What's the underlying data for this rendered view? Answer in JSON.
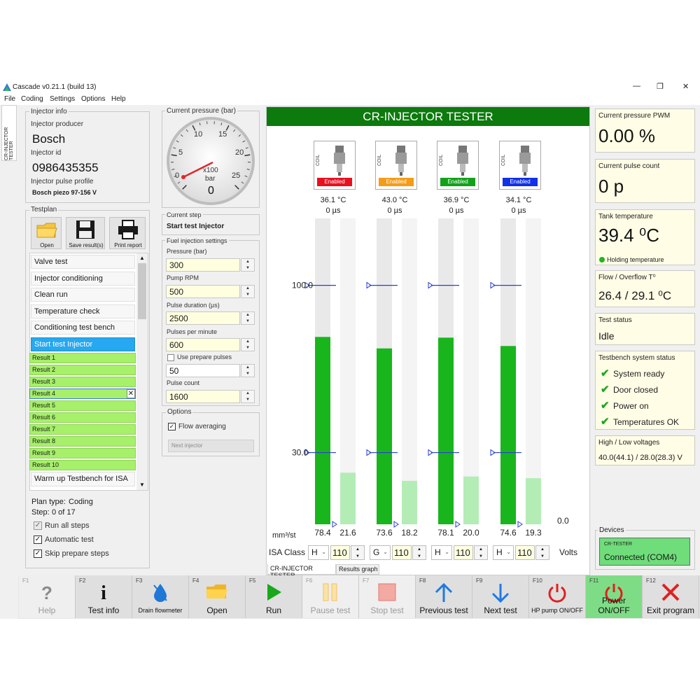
{
  "window": {
    "title": "Cascade v0.21.1 (build 13)",
    "controls": [
      "—",
      "❐",
      "✕"
    ]
  },
  "menu": [
    "File",
    "Coding",
    "Settings",
    "Options",
    "Help"
  ],
  "side_tab": "CR-INJECTOR TESTER",
  "injector_info": {
    "title": "Injector info",
    "producer_label": "Injector producer",
    "producer": "Bosch",
    "id_label": "Injector id",
    "id": "0986435355",
    "profile_label": "Injector pulse profile",
    "profile": "Bosch piezo 97-156 V"
  },
  "testplan": {
    "title": "Testplan",
    "buttons": {
      "open": "Open",
      "save": "Save result(s)",
      "print": "Print report"
    },
    "items": [
      "Valve test",
      "Injector conditioning",
      "Clean run",
      "Temperature check",
      "Conditioning test bench",
      "Start test Injector"
    ],
    "results": [
      "Result 1",
      "Result 2",
      "Result 3",
      "Result 4",
      "Result 5",
      "Result 6",
      "Result 7",
      "Result 8",
      "Result 9",
      "Result 10"
    ],
    "last_item": "Warm up Testbench for ISA",
    "plan_type_label": "Plan type:",
    "plan_type": "Coding",
    "step_label": "Step:",
    "step": "0 of 17",
    "checks": [
      "Run all steps",
      "Automatic test",
      "Skip prepare steps"
    ]
  },
  "gauge": {
    "title": "Current pressure (bar)",
    "ticks": [
      "0",
      "5",
      "10",
      "15",
      "20",
      "25"
    ],
    "unit_line1": "x100",
    "unit_line2": "bar",
    "value": "0"
  },
  "current_step": {
    "label": "Current step",
    "value": "Start test Injector"
  },
  "fuel_settings": {
    "title": "Fuel injection settings",
    "pressure_label": "Pressure (bar)",
    "pressure": "300",
    "pump_label": "Pump RPM",
    "pump": "500",
    "duration_label": "Pulse duration (µs)",
    "duration": "2500",
    "ppm_label": "Pulses per minute",
    "ppm": "600",
    "prepare_label": "Use prepare pulses",
    "prepare": "50",
    "count_label": "Pulse count",
    "count": "1600"
  },
  "options": {
    "title": "Options",
    "flow_averaging": "Flow averaging",
    "next_injector": "Next injector"
  },
  "tester": {
    "header": "CR-INJECTOR TESTER",
    "coil_label": "COIL",
    "injectors": [
      {
        "status": "Enabled",
        "color": "#e8101f",
        "temp": "36.1 °C",
        "time": "0 µs",
        "main": 78.4,
        "over": 21.6,
        "main_label": "78.4",
        "over_label": "21.6"
      },
      {
        "status": "Enabled",
        "color": "#f49c17",
        "temp": "43.0 °C",
        "time": "0 µs",
        "main": 73.6,
        "over": 18.2,
        "main_label": "73.6",
        "over_label": "18.2"
      },
      {
        "status": "Enabled",
        "color": "#12a21a",
        "temp": "36.9 °C",
        "time": "0 µs",
        "main": 78.1,
        "over": 20.0,
        "main_label": "78.1",
        "over_label": "20.0"
      },
      {
        "status": "Enabled",
        "color": "#1130e8",
        "temp": "34.1 °C",
        "time": "0 µs",
        "main": 74.6,
        "over": 19.3,
        "main_label": "74.6",
        "over_label": "19.3"
      }
    ],
    "scale_labels": [
      "100.0",
      "30.0",
      "0.0"
    ],
    "scale_values": [
      100.0,
      30.0,
      0.0
    ],
    "unit": "mm³/st",
    "isa_label": "ISA Class",
    "isa": [
      {
        "cls": "H",
        "val": "110"
      },
      {
        "cls": "G",
        "val": "110"
      },
      {
        "cls": "H",
        "val": "110"
      },
      {
        "cls": "H",
        "val": "110"
      }
    ],
    "volts_label": "Volts",
    "tabs": [
      "CR-INJECTOR TESTER",
      "Results graph"
    ]
  },
  "right": {
    "pwm_label": "Current pressure PWM",
    "pwm": "0.00 %",
    "pulse_label": "Current pulse count",
    "pulse": "0 p",
    "tank_label": "Tank temperature",
    "tank": "39.4 ⁰C",
    "holding": "Holding temperature",
    "flow_label": "Flow / Overflow T⁰",
    "flow": "26.4 / 29.1 ⁰C",
    "status_label": "Test status",
    "status": "Idle",
    "sys_label": "Testbench system status",
    "sys_items": [
      "System ready",
      "Door closed",
      "Power on",
      "Temperatures OK"
    ],
    "volt_label": "High / Low voltages",
    "volt": "40.0(44.1) / 28.0(28.3) V",
    "devices_label": "Devices",
    "device_name": "CR-TESTER",
    "device_status": "Connected (COM4)"
  },
  "fkeys": [
    {
      "key": "F1",
      "label": "Help",
      "icon": "help-icon"
    },
    {
      "key": "F2",
      "label": "Test info",
      "icon": "info-icon"
    },
    {
      "key": "F3",
      "label": "Drain flowmeter",
      "icon": "drain-icon"
    },
    {
      "key": "F4",
      "label": "Open",
      "icon": "folder-icon"
    },
    {
      "key": "F5",
      "label": "Run",
      "icon": "play-icon"
    },
    {
      "key": "F6",
      "label": "Pause test",
      "icon": "pause-icon"
    },
    {
      "key": "F7",
      "label": "Stop test",
      "icon": "stop-icon"
    },
    {
      "key": "F8",
      "label": "Previous test",
      "icon": "arrow-up-icon"
    },
    {
      "key": "F9",
      "label": "Next test",
      "icon": "arrow-down-icon"
    },
    {
      "key": "F10",
      "label": "HP pump ON/OFF",
      "icon": "power-icon"
    },
    {
      "key": "F11",
      "label": "Power ON/OFF",
      "icon": "power-icon"
    },
    {
      "key": "F12",
      "label": "Exit program",
      "icon": "exit-icon"
    }
  ]
}
